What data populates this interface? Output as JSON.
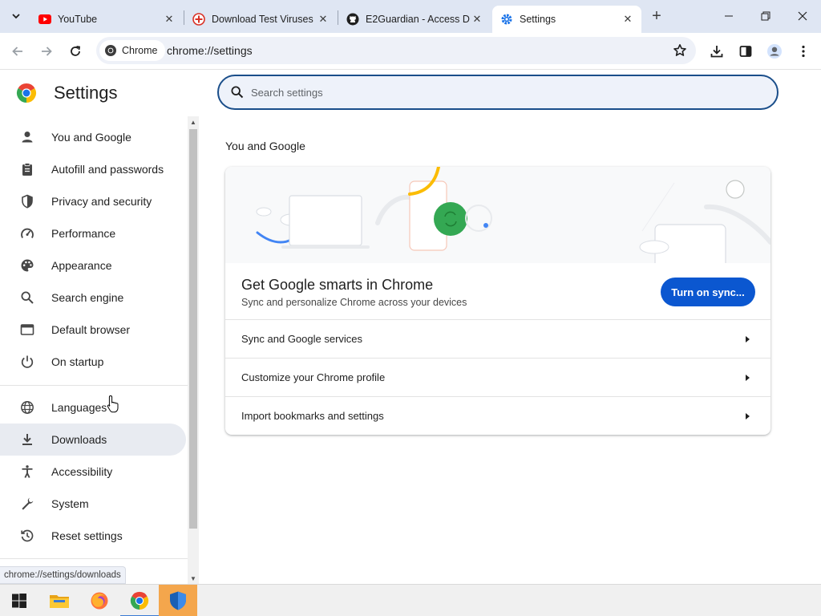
{
  "tabs": [
    {
      "title": "YouTube",
      "icon": "youtube-icon"
    },
    {
      "title": "Download Test Viruses",
      "icon": "eicar-icon"
    },
    {
      "title": "E2Guardian - Access D",
      "icon": "github-icon"
    },
    {
      "title": "Settings",
      "icon": "settings-gear-icon",
      "active": true
    }
  ],
  "omnibox": {
    "chip_label": "Chrome",
    "url": "chrome://settings"
  },
  "sidebar": {
    "title": "Settings",
    "items": [
      {
        "label": "You and Google",
        "icon": "person-icon"
      },
      {
        "label": "Autofill and passwords",
        "icon": "clipboard-icon"
      },
      {
        "label": "Privacy and security",
        "icon": "shield-icon"
      },
      {
        "label": "Performance",
        "icon": "speedometer-icon"
      },
      {
        "label": "Appearance",
        "icon": "palette-icon"
      },
      {
        "label": "Search engine",
        "icon": "search-icon"
      },
      {
        "label": "Default browser",
        "icon": "browser-window-icon"
      },
      {
        "label": "On startup",
        "icon": "power-icon"
      },
      {
        "label": "Languages",
        "icon": "globe-icon"
      },
      {
        "label": "Downloads",
        "icon": "download-icon",
        "selected": true
      },
      {
        "label": "Accessibility",
        "icon": "accessibility-icon"
      },
      {
        "label": "System",
        "icon": "wrench-icon"
      },
      {
        "label": "Reset settings",
        "icon": "reset-history-icon"
      }
    ]
  },
  "search": {
    "placeholder": "Search settings"
  },
  "main": {
    "section_title": "You and Google",
    "promo": {
      "title": "Get Google smarts in Chrome",
      "subtitle": "Sync and personalize Chrome across your devices",
      "button": "Turn on sync..."
    },
    "rows": [
      {
        "label": "Sync and Google services"
      },
      {
        "label": "Customize your Chrome profile"
      },
      {
        "label": "Import bookmarks and settings"
      }
    ]
  },
  "status_bar": "chrome://settings/downloads",
  "taskbar": {
    "items": [
      "windows-start-icon",
      "file-explorer-icon",
      "firefox-icon",
      "chrome-icon",
      "security-shield-icon"
    ]
  },
  "colors": {
    "accent": "#0b57d0",
    "selected_nav": "#e8ebf1",
    "titlebar": "#dfe6f3"
  }
}
